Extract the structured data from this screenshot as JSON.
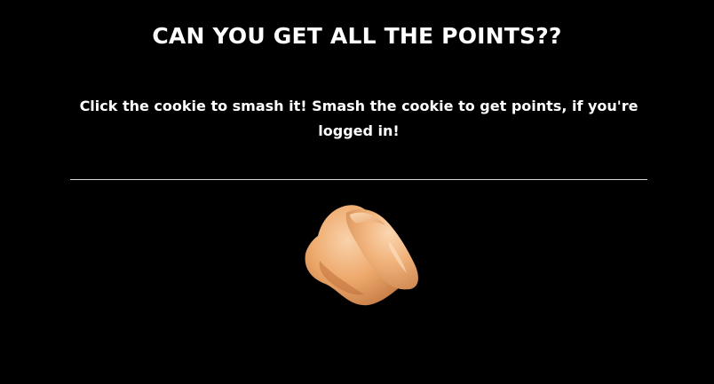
{
  "header": {
    "title": "CAN YOU GET ALL THE POINTS??"
  },
  "instructions": {
    "text": "Click the cookie to smash it! Smash the cookie to get points, if you're logged in!"
  },
  "cookie": {
    "icon": "fortune-cookie-icon"
  },
  "colors": {
    "background": "#000000",
    "text": "#ffffff",
    "divider": "#d8d8d8",
    "cookie_light": "#f7c69a",
    "cookie_mid": "#e8a263",
    "cookie_dark": "#c97a45"
  }
}
